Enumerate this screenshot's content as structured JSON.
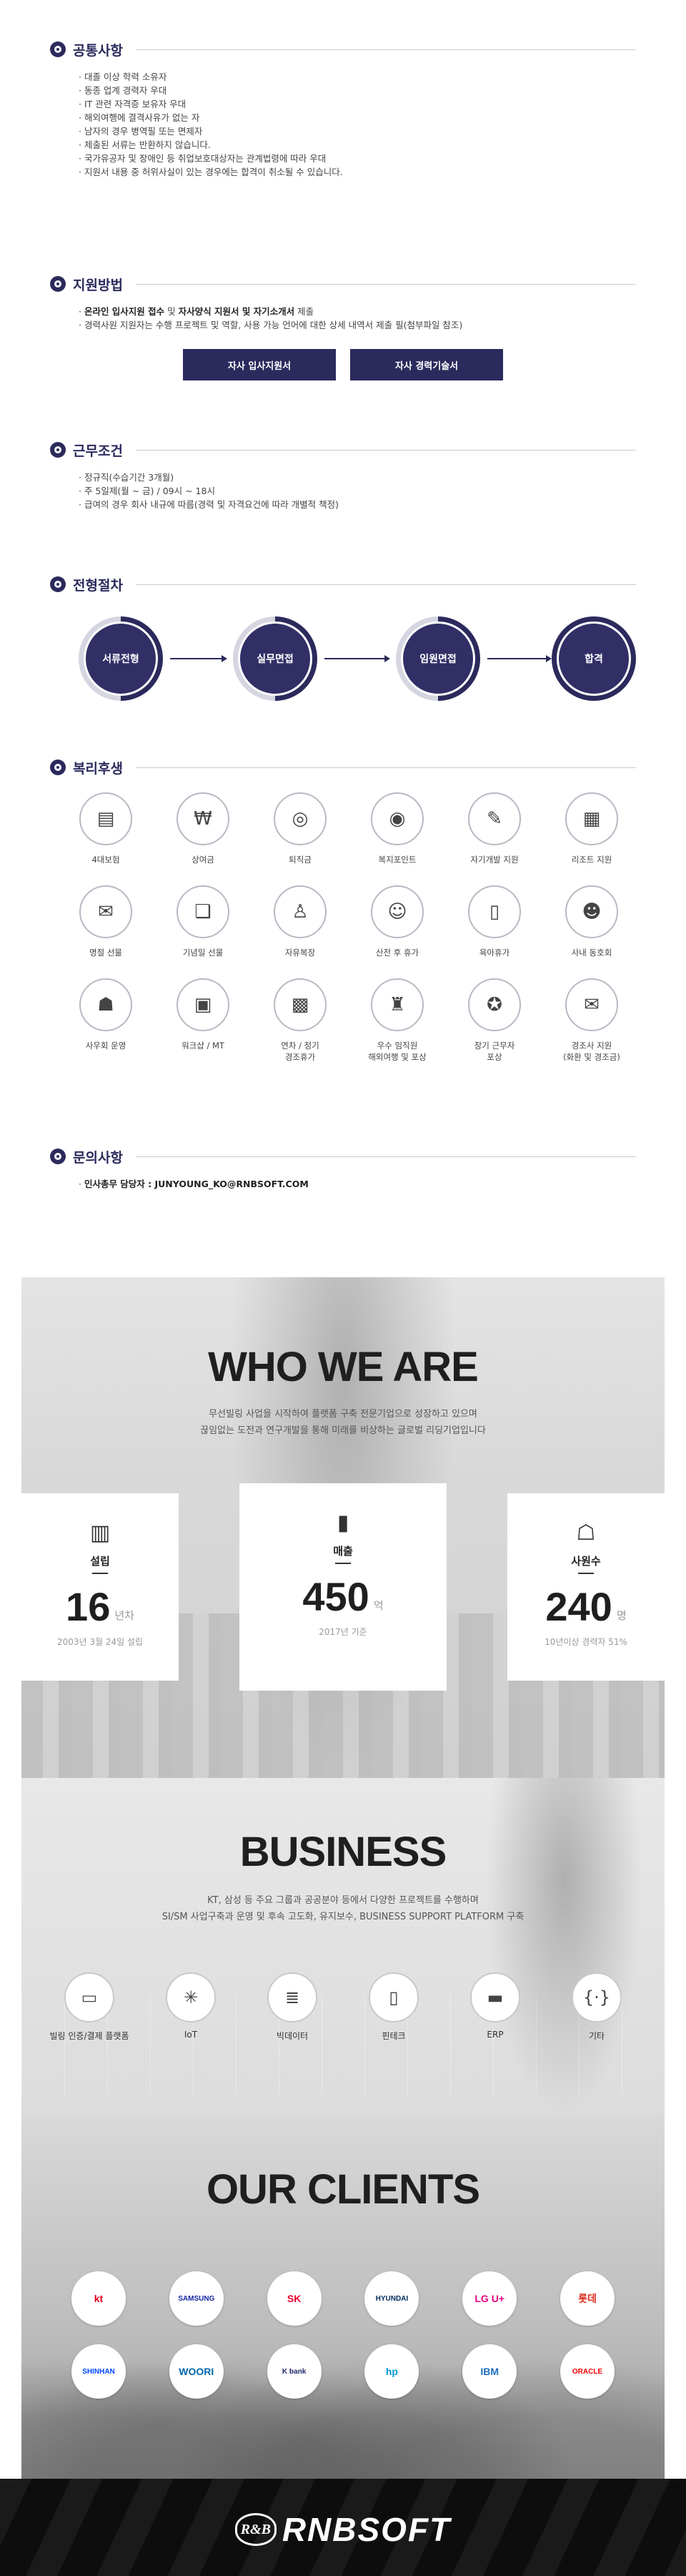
{
  "sections": {
    "qualification": {
      "title": "공통사항",
      "items": [
        "대졸 이상 학력 소유자",
        "동종 업계 경력자 우대",
        "IT 관련 자격증 보유자 우대",
        "해외여행에 결격사유가 없는 자",
        "남자의 경우 병역필 또는 면제자",
        "제출된 서류는 반환하지 않습니다.",
        "국가유공자 및 장애인 등 취업보호대상자는 관계법령에 따라 우대",
        "지원서 내용 중 허위사실이 있는 경우에는 합격이 취소될 수 있습니다."
      ]
    },
    "apply": {
      "title": "지원방법",
      "line1_bold1": "온라인 입사지원 접수",
      "line1_mid": " 및 ",
      "line1_bold2": "자사양식 지원서 및 자기소개서",
      "line1_tail": " 제출",
      "line2": "경력사원 지원자는 수행 프로젝트 및 역할, 사용 가능 언어에 대한 상세 내역서 제출 필(첨부파일 참조)",
      "btn_application": "자사 입사지원서",
      "btn_career": "자사 경력기술서"
    },
    "conditions": {
      "title": "근무조건",
      "items": [
        "정규직(수습기간 3개월)",
        "주 5일제(월 ~ 금)  /  09시 ~ 18시",
        "급여의 경우 회사 내규에 따름(경력 및 자격요건에 따라 개별적 책정)"
      ]
    },
    "process": {
      "title": "전형절차",
      "steps": [
        "서류전형",
        "실무면접",
        "임원면접",
        "합격"
      ]
    },
    "benefits": {
      "title": "복리후생",
      "items": [
        {
          "label": "4대보험",
          "icon": "insurance-icon",
          "glyph": "▤"
        },
        {
          "label": "상여금",
          "icon": "money-bag-icon",
          "glyph": "₩"
        },
        {
          "label": "퇴직금",
          "icon": "coins-icon",
          "glyph": "◎"
        },
        {
          "label": "복지포인트",
          "icon": "points-icon",
          "glyph": "◉"
        },
        {
          "label": "자기개발 지원",
          "icon": "certificate-icon",
          "glyph": "✎"
        },
        {
          "label": "리조트 지원",
          "icon": "building-icon",
          "glyph": "▦"
        },
        {
          "label": "명절 선물",
          "icon": "envelope-icon",
          "glyph": "✉"
        },
        {
          "label": "기념일 선물",
          "icon": "gift-icon",
          "glyph": "❏"
        },
        {
          "label": "자유복장",
          "icon": "shirt-icon",
          "glyph": "♙"
        },
        {
          "label": "산전 후 휴가",
          "icon": "mother-icon",
          "glyph": "☺"
        },
        {
          "label": "육아휴가",
          "icon": "baby-bottle-icon",
          "glyph": "▯"
        },
        {
          "label": "사내 동호회",
          "icon": "group-icon",
          "glyph": "☻"
        },
        {
          "label": "사우회 운영",
          "icon": "people-icon",
          "glyph": "☗"
        },
        {
          "label": "워크샵 / MT",
          "icon": "bus-icon",
          "glyph": "▣"
        },
        {
          "label": "연차 / 정기\n경조휴가",
          "icon": "calendar-icon",
          "glyph": "▩"
        },
        {
          "label": "우수 임직원\n해외여행 및 포상",
          "icon": "eiffel-tower-icon",
          "glyph": "♜"
        },
        {
          "label": "장기 근무자\n포상",
          "icon": "medal-icon",
          "glyph": "✪"
        },
        {
          "label": "경조사 지원\n(화환 및 경조금)",
          "icon": "money-envelope-icon",
          "glyph": "✉"
        }
      ]
    },
    "contact": {
      "title": "문의사항",
      "text": "인사총무 담당자 : JUNYOUNG_KO@RNBSOFT.COM"
    }
  },
  "who": {
    "title": "WHO WE ARE",
    "desc1": "무선빌링 사업을 시작하여 플랫폼 구축 전문기업으로 성장하고 있으며",
    "desc2": "끊임없는 도전과 연구개발을 통해 미래를 비상하는 글로벌 리딩기업입니다",
    "cards": [
      {
        "title": "설립",
        "number": "16",
        "unit": "년차",
        "note": "2003년 3월 24일 설립",
        "icon": "building-icon",
        "glyph": "▥"
      },
      {
        "title": "매출",
        "number": "450",
        "unit": "억",
        "note": "2017년 기준",
        "icon": "bar-chart-icon",
        "glyph": "▮"
      },
      {
        "title": "사원수",
        "number": "240",
        "unit": "명",
        "note": "10년이상 경력자 51%",
        "icon": "person-icon",
        "glyph": "☖"
      }
    ]
  },
  "business": {
    "title": "BUSINESS",
    "desc1": "KT, 삼성 등 주요 그룹과 공공분야 등에서 다양한 프로젝트를 수행하며",
    "desc2": "SI/SM 사업구축과 운영 및 후속 고도화, 유지보수, BUSINESS SUPPORT PLATFORM 구축",
    "items": [
      {
        "label": "빌링 인증/결제 플랫폼",
        "icon": "payment-icon",
        "glyph": "▭"
      },
      {
        "label": "IoT",
        "icon": "network-icon",
        "glyph": "✳"
      },
      {
        "label": "빅데이터",
        "icon": "database-icon",
        "glyph": "≣"
      },
      {
        "label": "핀테크",
        "icon": "mobile-icon",
        "glyph": "▯"
      },
      {
        "label": "ERP",
        "icon": "monitor-icon",
        "glyph": "▬"
      },
      {
        "label": "기타",
        "icon": "code-icon",
        "glyph": "{·}"
      }
    ]
  },
  "clients": {
    "title": "OUR CLIENTS",
    "row1": [
      {
        "name": "kt",
        "color": "#e2001a"
      },
      {
        "name": "SAMSUNG",
        "color": "#1428a0"
      },
      {
        "name": "SK",
        "color": "#ea002c"
      },
      {
        "name": "HYUNDAI",
        "color": "#002c5f"
      },
      {
        "name": "LG U+",
        "color": "#e6007e"
      },
      {
        "name": "롯데",
        "color": "#da291c"
      }
    ],
    "row2": [
      {
        "name": "SHINHAN",
        "color": "#0046ff"
      },
      {
        "name": "WOORI",
        "color": "#0067ac"
      },
      {
        "name": "K bank",
        "color": "#1f2a6b"
      },
      {
        "name": "hp",
        "color": "#0096d6"
      },
      {
        "name": "IBM",
        "color": "#1f70c1"
      },
      {
        "name": "ORACLE",
        "color": "#f80000"
      }
    ]
  },
  "footer": {
    "mark": "R&B",
    "brand": "RNBSOFT"
  },
  "theme": {
    "accent": "#2b2a5c"
  }
}
